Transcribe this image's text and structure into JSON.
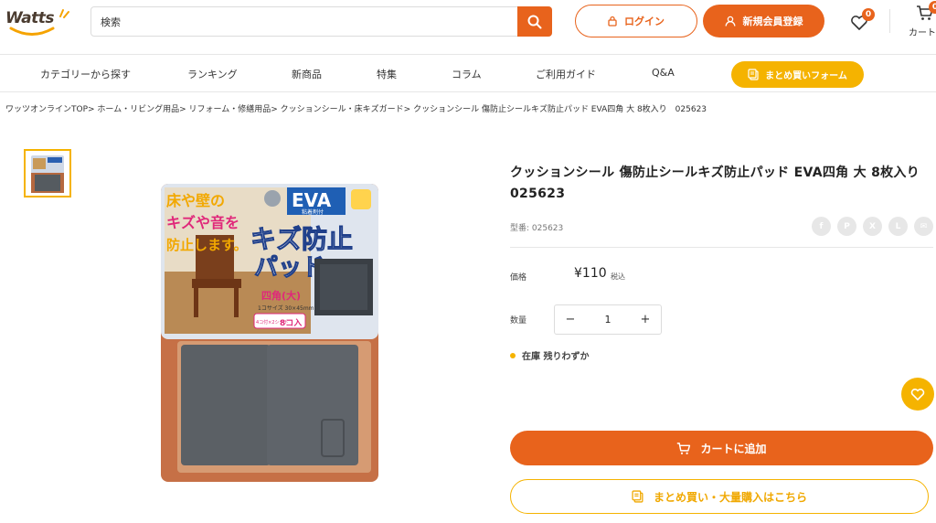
{
  "header": {
    "logo_text": "Watts",
    "search_placeholder": "検索",
    "login_label": "ログイン",
    "register_label": "新規会員登録",
    "wishlist_count": "0",
    "cart_count": "0",
    "cart_label": "カート"
  },
  "nav": {
    "items": [
      "カテゴリーから探す",
      "ランキング",
      "新商品",
      "特集",
      "コラム",
      "ご利用ガイド",
      "Q&A"
    ],
    "bulk_form_label": "まとめ買いフォーム"
  },
  "breadcrumb": "ワッツオンラインTOP> ホーム・リビング用品> リフォーム・修繕用品> クッションシール・床キズガード> クッションシール 傷防止シールキズ防止パッド EVA四角 大 8枚入り　025623",
  "product": {
    "title": "クッションシール 傷防止シールキズ防止パッド EVA四角 大 8枚入り　025623",
    "sku": "型番: 025623",
    "price_label": "価格",
    "price": "¥110",
    "tax_label": "税込",
    "qty_label": "数量",
    "qty_value": "1",
    "stock": "在庫 残りわずか",
    "add_to_cart": "カートに追加",
    "bulk_buy": "まとめ買い・大量購入はこちら"
  },
  "package": {
    "eva": "EVA",
    "eva_sub": "粘着剤付",
    "headline_1": "床や壁の",
    "headline_2": "キズや音を",
    "headline_3": "防止します。",
    "product_name_1": "キズ防止",
    "product_name_2": "パッド",
    "shape": "四角(大)",
    "size": "1コサイズ 30×45mm",
    "count_note": "4コ付×2シート",
    "count": "8コ入"
  },
  "colors": {
    "accent": "#e8631c",
    "yellow": "#f5b300"
  }
}
